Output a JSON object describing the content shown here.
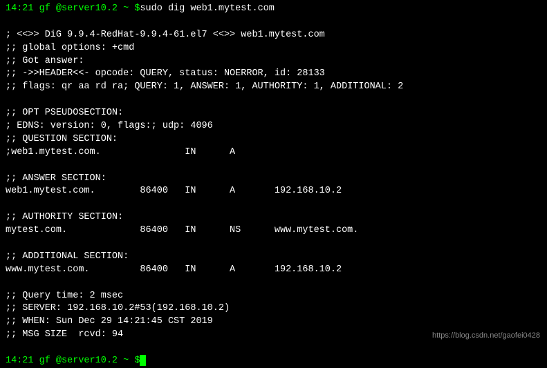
{
  "prompt1": {
    "time": "14:21",
    "user_host": " gf @server10.2 ~ ",
    "dollar": "$",
    "command": "sudo dig web1.mytest.com"
  },
  "output": {
    "l1": "; <<>> DiG 9.9.4-RedHat-9.9.4-61.el7 <<>> web1.mytest.com",
    "l2": ";; global options: +cmd",
    "l3": ";; Got answer:",
    "l4": ";; ->>HEADER<<- opcode: QUERY, status: NOERROR, id: 28133",
    "l5": ";; flags: qr aa rd ra; QUERY: 1, ANSWER: 1, AUTHORITY: 1, ADDITIONAL: 2",
    "l6": ";; OPT PSEUDOSECTION:",
    "l7": "; EDNS: version: 0, flags:; udp: 4096",
    "l8": ";; QUESTION SECTION:",
    "l9": ";web1.mytest.com.               IN      A",
    "l10": ";; ANSWER SECTION:",
    "l11": "web1.mytest.com.        86400   IN      A       192.168.10.2",
    "l12": ";; AUTHORITY SECTION:",
    "l13": "mytest.com.             86400   IN      NS      www.mytest.com.",
    "l14": ";; ADDITIONAL SECTION:",
    "l15": "www.mytest.com.         86400   IN      A       192.168.10.2",
    "l16": ";; Query time: 2 msec",
    "l17": ";; SERVER: 192.168.10.2#53(192.168.10.2)",
    "l18": ";; WHEN: Sun Dec 29 14:21:45 CST 2019",
    "l19": ";; MSG SIZE  rcvd: 94"
  },
  "prompt2": {
    "time": "14:21",
    "user_host": " gf @server10.2 ~ ",
    "dollar": "$"
  },
  "watermark": "https://blog.csdn.net/gaofei0428"
}
